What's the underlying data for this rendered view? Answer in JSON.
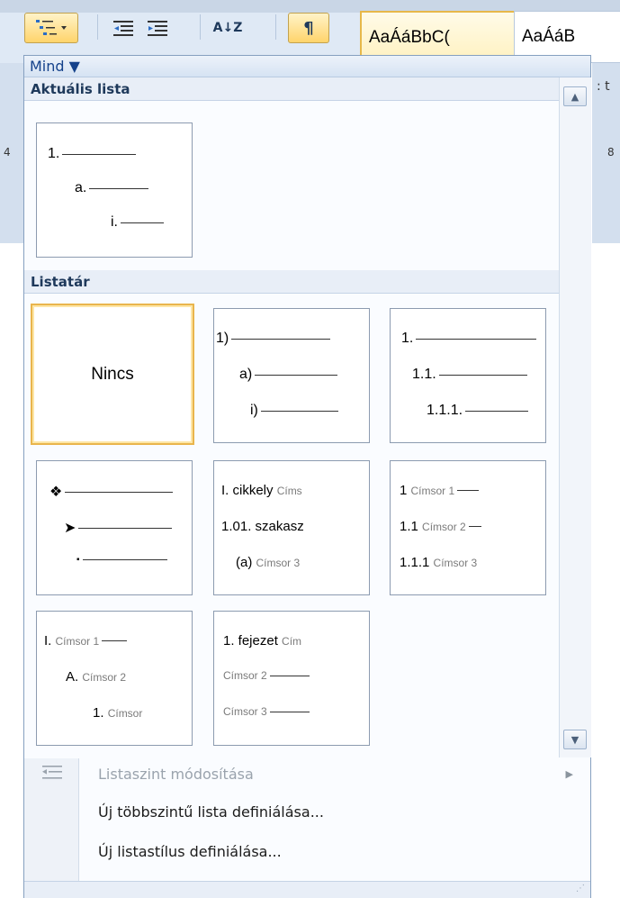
{
  "ribbon": {
    "style1": "AaÁáBbC(",
    "style2": "AaÁáB",
    "pilcrow": "¶",
    "sort_label": "A↓Z",
    "ruler_4": "4",
    "ruler_8": "8",
    "partial_text": ": t"
  },
  "menu": {
    "filter_label": "Mind ▼",
    "current_section": "Aktuális lista",
    "library_section": "Listatár",
    "current_tile": {
      "lines": [
        "1.",
        "a.",
        "i."
      ]
    },
    "tiles": [
      {
        "type": "none",
        "text": "Nincs"
      },
      {
        "type": "lines",
        "lines": [
          "1)",
          "a)",
          "i)"
        ]
      },
      {
        "type": "lines",
        "lines": [
          "1.",
          "1.1.",
          "1.1.1."
        ]
      },
      {
        "type": "bullets",
        "lines": [
          "❖",
          "➤",
          "▪"
        ]
      },
      {
        "type": "labeled",
        "lines": [
          {
            "a": "I. cikkely",
            "b": "Címs"
          },
          {
            "a": "1.01. szakasz",
            "b": ""
          },
          {
            "a": "(a)",
            "b": "Címsor 3"
          }
        ]
      },
      {
        "type": "labeled",
        "lines": [
          {
            "a": "1",
            "b": "Címsor 1"
          },
          {
            "a": "1.1",
            "b": "Címsor 2"
          },
          {
            "a": "1.1.1",
            "b": "Címsor 3"
          }
        ]
      },
      {
        "type": "labeled",
        "lines": [
          {
            "a": "I.",
            "b": "Címsor 1"
          },
          {
            "a": "A.",
            "b": "Címsor 2"
          },
          {
            "a": "1.",
            "b": "Címsor"
          }
        ]
      },
      {
        "type": "labeled",
        "lines": [
          {
            "a": "1. fejezet",
            "b": "Cím"
          },
          {
            "a": "",
            "b": "Címsor 2"
          },
          {
            "a": "",
            "b": "Címsor 3"
          }
        ]
      }
    ],
    "commands": [
      {
        "label": "Listaszint módosítása",
        "enabled": false,
        "submenu": true
      },
      {
        "label": "Új többszintű lista definiálása...",
        "enabled": true
      },
      {
        "label": "Új listastílus definiálása...",
        "enabled": true
      }
    ]
  },
  "colors": {
    "selected_border": "#e9b54d",
    "header_text": "#1e395b"
  }
}
